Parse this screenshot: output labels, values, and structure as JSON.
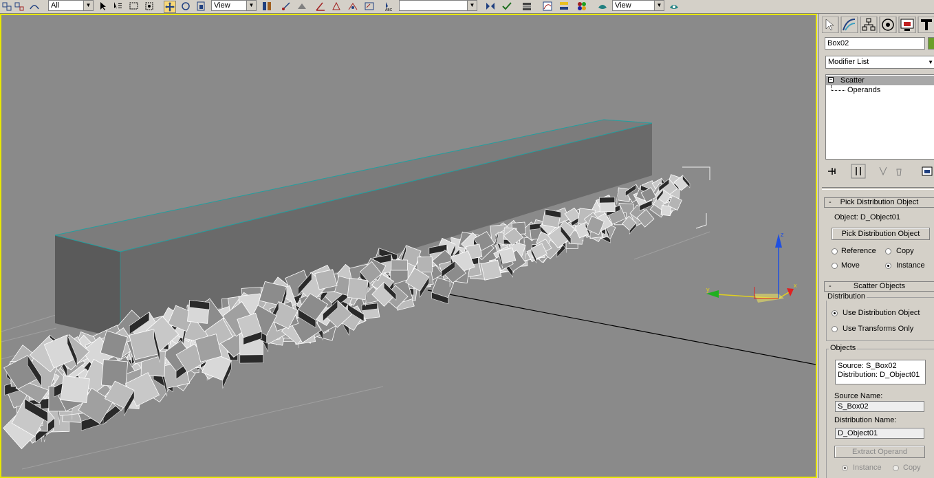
{
  "toolbar": {
    "selection_filter": "All",
    "reference_coord": "View",
    "named_selection": "",
    "reference_coord_2": "View"
  },
  "viewport": {
    "axis_labels": {
      "x": "x",
      "y": "y",
      "z": "z"
    }
  },
  "command_panel": {
    "tabs": [
      "create-tab",
      "modify-tab",
      "hierarchy-tab",
      "motion-tab",
      "display-tab",
      "utilities-tab"
    ],
    "object_name": "Box02",
    "object_color": "#6a9e2a",
    "modifier_list": "Modifier List",
    "stack": {
      "item": "Scatter",
      "sub_item": "Operands"
    },
    "pick_distribution": {
      "title": "Pick Distribution Object",
      "object_label": "Object: D_Object01",
      "pick_button": "Pick Distribution Object",
      "options": [
        "Reference",
        "Copy",
        "Move",
        "Instance"
      ],
      "selected": "Instance"
    },
    "scatter_objects": {
      "title": "Scatter Objects",
      "distribution_group": "Distribution",
      "use_distribution": "Use Distribution Object",
      "use_transforms": "Use Transforms Only",
      "objects_group": "Objects",
      "source_line": "Source: S_Box02",
      "distribution_line": "Distribution: D_Object01",
      "source_name_label": "Source Name:",
      "source_name_value": "S_Box02",
      "distribution_name_label": "Distribution Name:",
      "distribution_name_value": "D_Object01",
      "extract_button": "Extract Operand",
      "extract_options": [
        "Instance",
        "Copy"
      ]
    }
  }
}
